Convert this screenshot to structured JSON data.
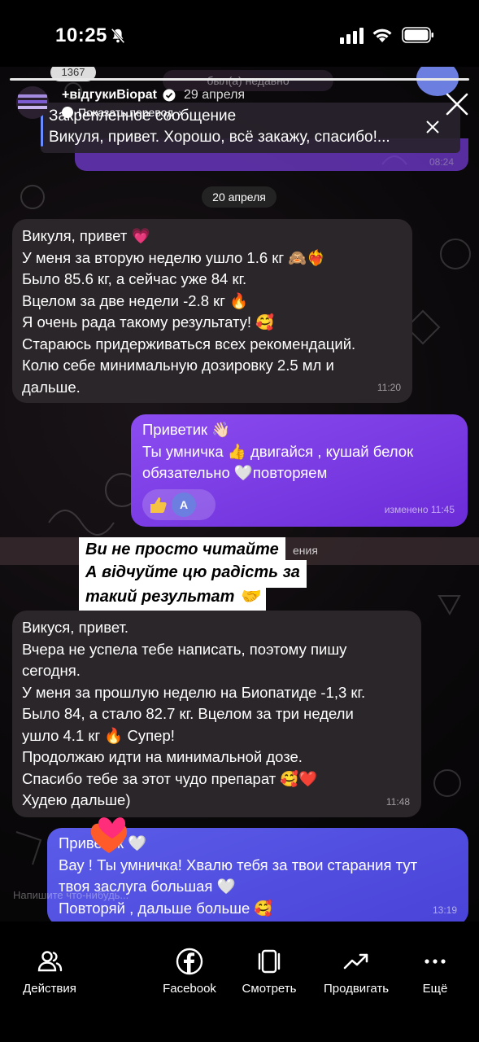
{
  "status_bar": {
    "time": "10:25"
  },
  "story": {
    "username": "+відгукиBiopat",
    "date": "29 апреля",
    "translate_label": "Показать перевод",
    "close_icon": "close-icon"
  },
  "chat_background": {
    "last_seen": "был(а) недавно",
    "counter": "1367",
    "pinned_title": "Закрепленное сообщение",
    "pinned_text": "Викуля, привет. Хорошо, всё закажу, спасибо!...",
    "pinned_time": "08:24",
    "date_separator": "20 апреля",
    "messages": [
      {
        "lines": [
          "Викуля, привет 💗",
          "У меня за вторую неделю ушло 1.6 кг 🙈❤️‍🔥",
          "Было 85.6 кг, а сейчас уже 84 кг.",
          "Вцелом за две недели -2.8 кг 🔥",
          "Я очень рада такому результату! 🥰",
          "Стараюсь придерживаться всех рекомендаций.",
          "Колю себе минимальную дозировку 2.5 мл и",
          "дальше."
        ],
        "time": "11:20"
      },
      {
        "lines": [
          "Приветик 👋🏻",
          "Ты умничка 👍  двигайся , кушай белок",
          "обязательно 🤍повторяем"
        ],
        "reaction_avatar": "A",
        "status": "изменено 11:45"
      },
      {
        "lines": [
          "Викуся, привет.",
          "Вчера не успела тебе написать, поэтому пишу",
          "сегодня.",
          "У меня за прошлую неделю на Биопатиде -1,3 кг.",
          "Было 84, а стало 82.7 кг. Вцелом за три недели",
          "ушло 4.1 кг 🔥 Супер!",
          "Продолжаю идти на минимальной дозе.",
          "Спасибо тебе за этот чудо препарат 🥰❤️",
          "Худею дальше)"
        ],
        "time": "11:48"
      },
      {
        "lines": [
          "Приветик 🤍",
          "Вау ! Ты умничка! Хвалю тебя за твои старания тут",
          "твоя заслуга большая 🤍",
          "Повторяй , дальше больше 🥰"
        ],
        "time": "13:19"
      }
    ],
    "hidden_divider": "ения",
    "input_placeholder": "Напишите что-нибудь..."
  },
  "caption": {
    "line1": "Ви не просто читайте",
    "line2": "А відчуйте цю радість за",
    "line3": "такий результат 🤝"
  },
  "toolbar": {
    "items": [
      {
        "label": "Действия",
        "icon": "people-icon"
      },
      {
        "label": "Facebook",
        "icon": "facebook-icon"
      },
      {
        "label": "Смотреть",
        "icon": "watch-icon"
      },
      {
        "label": "Продвигать",
        "icon": "trend-icon"
      },
      {
        "label": "Ещё",
        "icon": "more-icon"
      }
    ]
  },
  "colors": {
    "outgoing_bubble": "#7a3ee0",
    "incoming_bubble": "#2b2629",
    "last_bubble": "#5150e0",
    "caption_bg": "#ffffff"
  }
}
